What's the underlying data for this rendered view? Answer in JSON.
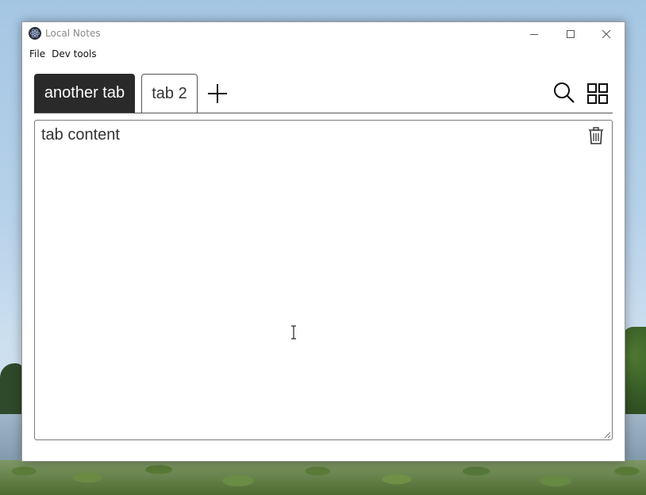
{
  "window": {
    "title": "Local Notes"
  },
  "menu": {
    "items": [
      {
        "label": "File"
      },
      {
        "label": "Dev tools"
      }
    ]
  },
  "tabs": [
    {
      "label": "another tab",
      "active": true
    },
    {
      "label": "tab 2",
      "active": false
    }
  ],
  "toolbar": {
    "add_icon": "plus-icon",
    "search_icon": "search-icon",
    "view_icon": "grid-icon"
  },
  "editor": {
    "content": "tab content",
    "delete_icon": "trash-icon"
  },
  "colors": {
    "active_tab_bg": "#2a2a2a",
    "active_tab_text": "#ffffff",
    "border": "#555555"
  }
}
